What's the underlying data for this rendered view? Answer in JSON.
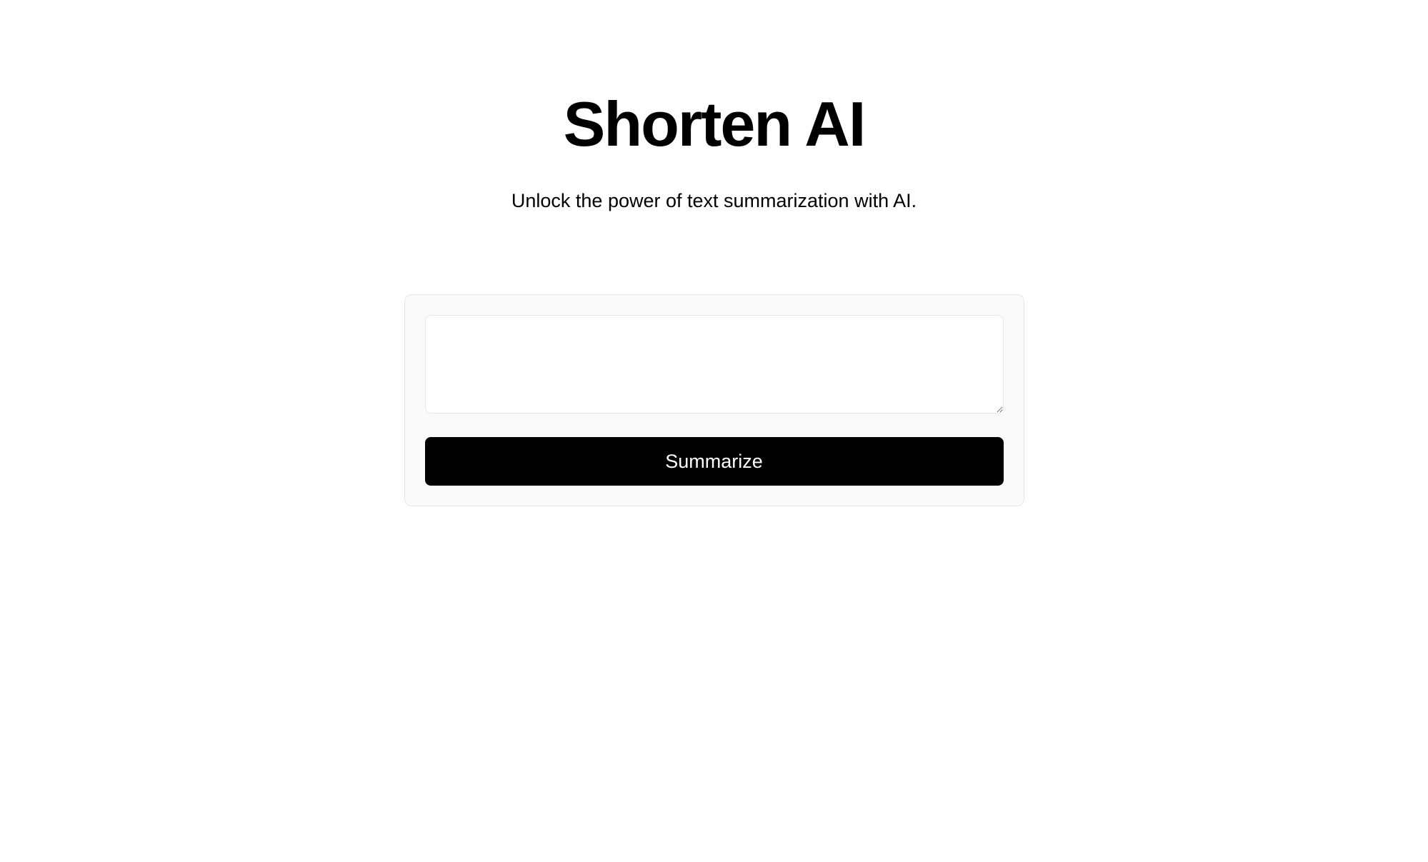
{
  "header": {
    "title": "Shorten AI",
    "subtitle": "Unlock the power of text summarization with AI."
  },
  "form": {
    "textarea_value": "",
    "button_label": "Summarize"
  }
}
